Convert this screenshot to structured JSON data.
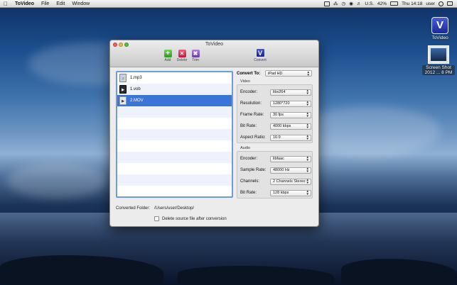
{
  "menubar": {
    "app": "ToVideo",
    "menus": [
      "File",
      "Edit",
      "Window"
    ],
    "locale": "U.S.",
    "battery": "42%",
    "clock": "Thu 14:18",
    "user": "user"
  },
  "desktop": {
    "app_icon_label": "ToVideo",
    "screenshot_label_line1": "Screen Shot",
    "screenshot_label_line2": "2012 ... 8 PM"
  },
  "window": {
    "title": "ToVideo",
    "toolbar": {
      "add": "Add",
      "delete": "Delete",
      "trim": "Trim",
      "convert": "Convert"
    },
    "files": [
      {
        "name": "1.mp3",
        "icon": "audio-file-icon",
        "selected": false
      },
      {
        "name": "1.vob",
        "icon": "video-file-icon",
        "selected": false
      },
      {
        "name": "2.MOV",
        "icon": "mov-file-icon",
        "selected": true
      }
    ],
    "convert_to_label": "Convert To:",
    "convert_to_value": "iPad HD",
    "video": {
      "title": "Video",
      "fields": [
        {
          "label": "Encoder:",
          "value": "libx264"
        },
        {
          "label": "Resolution:",
          "value": "1280*720"
        },
        {
          "label": "Frame Rate:",
          "value": "30 fps"
        },
        {
          "label": "Bit Rate:",
          "value": "4000 kbps"
        },
        {
          "label": "Aspect Ratio:",
          "value": "16:9"
        }
      ]
    },
    "audio": {
      "title": "Audio",
      "fields": [
        {
          "label": "Encoder:",
          "value": "libfaac"
        },
        {
          "label": "Sample Rate:",
          "value": "48000 Hz"
        },
        {
          "label": "Channels:",
          "value": "2 Channels Stereo"
        },
        {
          "label": "Bit Rate:",
          "value": "128 kbps"
        }
      ]
    },
    "converted_folder_label": "Converted Folder:",
    "converted_folder_path": "/Users/user/Desktop/",
    "delete_source_label": "Delete source file after conversion",
    "delete_source_checked": false
  },
  "colors": {
    "selection": "#3a74d6",
    "list_border": "#6b9cdc",
    "app_icon": "#2a38b8"
  }
}
